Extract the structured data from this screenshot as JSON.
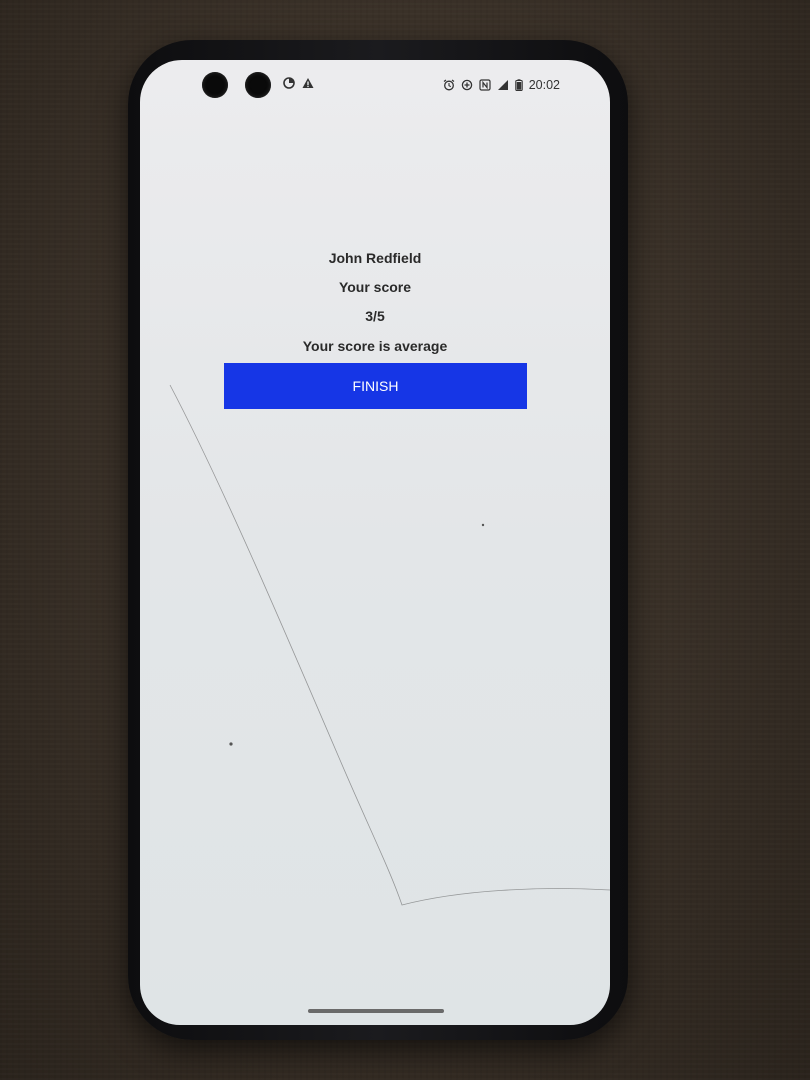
{
  "status_bar": {
    "time": "20:02",
    "left_icons": [
      "data-saver-icon",
      "warning-icon"
    ],
    "right_icons": [
      "alarm-icon",
      "data-saver-plus-icon",
      "nfc-icon",
      "signal-icon",
      "battery-icon"
    ]
  },
  "result": {
    "user_name": "John Redfield",
    "score_label": "Your score",
    "score_value": "3/5",
    "assessment": "Your score is average"
  },
  "actions": {
    "finish_label": "FINISH"
  },
  "colors": {
    "button_bg": "#1636e6",
    "button_text": "#ffffff",
    "screen_bg": "#e6e8ea",
    "text": "#2a2a2a"
  }
}
